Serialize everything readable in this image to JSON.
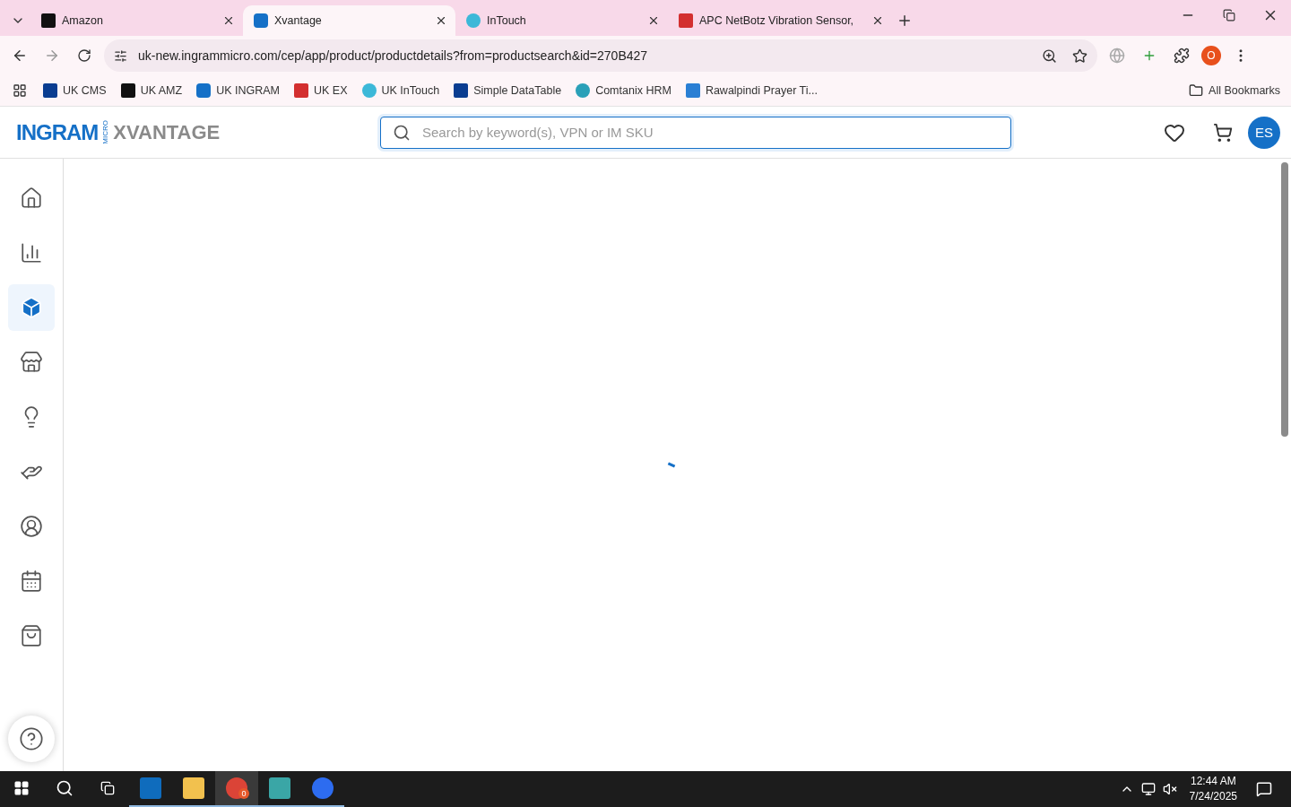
{
  "browser": {
    "tabs": [
      {
        "title": "Amazon",
        "selected": false,
        "kind": "amazon"
      },
      {
        "title": "Xvantage",
        "selected": true,
        "kind": "ingram"
      },
      {
        "title": "InTouch",
        "selected": false,
        "kind": "intouch"
      },
      {
        "title": "APC NetBotz Vibration Sensor,",
        "selected": false,
        "kind": "ex"
      }
    ],
    "url": "uk-new.ingrammicro.com/cep/app/product/productdetails?from=productsearch&id=270B427",
    "profile": "O",
    "bookmarks": [
      {
        "label": "UK CMS",
        "kind": "df"
      },
      {
        "label": "UK AMZ",
        "kind": "amazon"
      },
      {
        "label": "UK INGRAM",
        "kind": "ingram"
      },
      {
        "label": "UK EX",
        "kind": "ex"
      },
      {
        "label": "UK InTouch",
        "kind": "intouch"
      },
      {
        "label": "Simple DataTable",
        "kind": "df"
      },
      {
        "label": "Comtanix HRM",
        "kind": "comtanix"
      },
      {
        "label": "Rawalpindi Prayer Ti...",
        "kind": "prayer"
      }
    ],
    "all_bookmarks": "All Bookmarks"
  },
  "header": {
    "logo": {
      "brand": "INGRAM",
      "micro": "MICRO",
      "product": "XVANTAGE"
    },
    "search": {
      "placeholder": "Search by keyword(s), VPN or IM SKU"
    },
    "avatar": "ES"
  },
  "sidebar": {
    "items": [
      {
        "kind": "home",
        "selected": false
      },
      {
        "kind": "chart",
        "selected": false
      },
      {
        "kind": "box",
        "selected": true
      },
      {
        "kind": "store",
        "selected": false
      },
      {
        "kind": "idea",
        "selected": false
      },
      {
        "kind": "hand",
        "selected": false
      },
      {
        "kind": "network",
        "selected": false
      },
      {
        "kind": "calendar",
        "selected": false
      },
      {
        "kind": "bag",
        "selected": false
      }
    ]
  },
  "taskbar": {
    "apps": [
      {
        "kind": "outlook",
        "selected": false
      },
      {
        "kind": "files",
        "selected": false
      },
      {
        "kind": "chrome",
        "selected": true,
        "badge": "0"
      },
      {
        "kind": "gem",
        "selected": false
      },
      {
        "kind": "zoom",
        "selected": false
      }
    ],
    "time": "12:44 AM",
    "date": "7/24/2025"
  }
}
